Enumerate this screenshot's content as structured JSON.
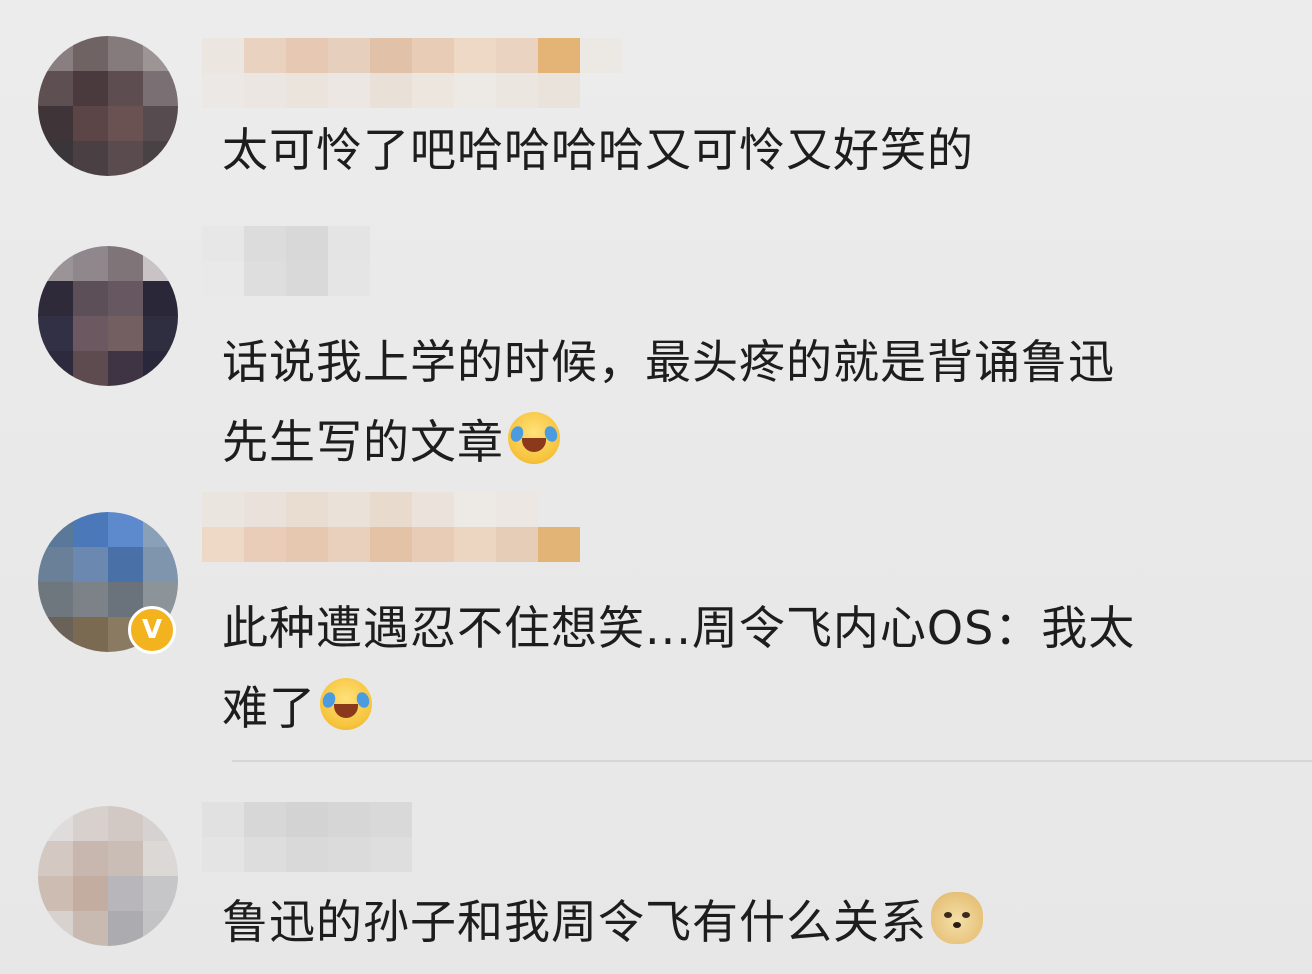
{
  "comments": [
    {
      "text": "太可怜了吧哈哈哈哈又可怜又好笑的",
      "emoji": ""
    },
    {
      "text": "话说我上学的时候，最头疼的就是背诵鲁迅\n先生写的文章",
      "emoji": "laughing-crying-emoji"
    },
    {
      "text": "此种遭遇忍不住想笑...周令飞内心OS：我太\n难了",
      "emoji": "laughing-crying-emoji",
      "verified_badge": "V"
    },
    {
      "text": "鲁迅的孙子和我周令飞有什么关系",
      "emoji": "doge-emoji"
    }
  ],
  "colors": {
    "background": "#ebebeb",
    "text": "#1d1d1d",
    "verified_badge": "#f2b31e",
    "divider": "#d6d6d6"
  }
}
